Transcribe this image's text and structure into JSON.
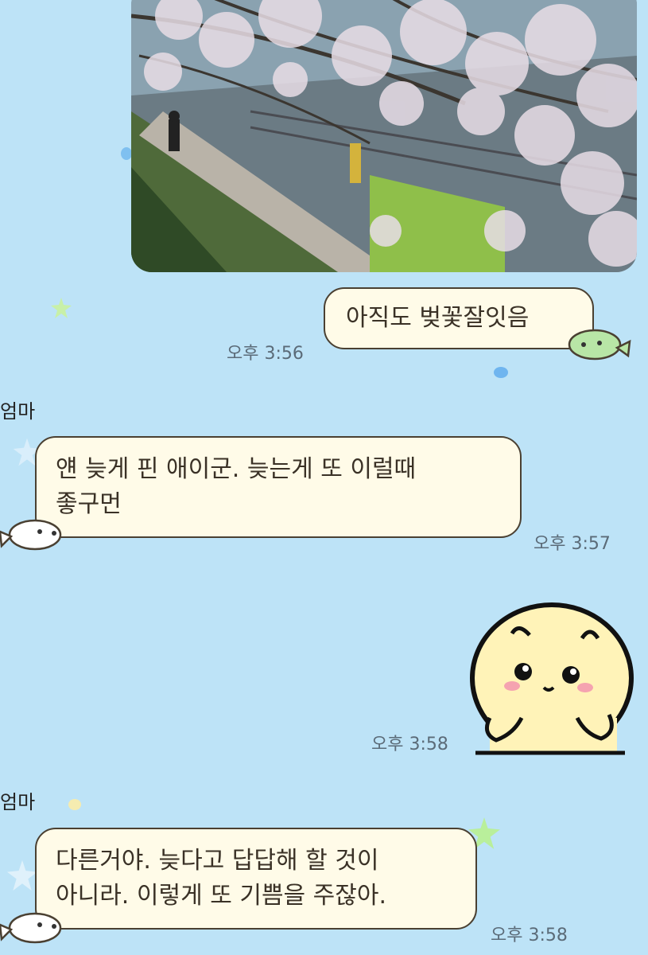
{
  "chat": {
    "messages": [
      {
        "side": "me",
        "type": "photo"
      },
      {
        "side": "me",
        "type": "text",
        "text": "아직도 벚꽃잘잇음",
        "time": "오후 3:56"
      },
      {
        "side": "other",
        "sender": "엄마",
        "type": "text",
        "lines": [
          "얜 늦게 핀 애이군. 늦는게 또 이럴때",
          "좋구먼"
        ],
        "time": "오후 3:57"
      },
      {
        "side": "me",
        "type": "sticker",
        "sticker": "blushing-yellow-character-sticker",
        "time": "오후 3:58"
      },
      {
        "side": "other",
        "sender": "엄마",
        "type": "text",
        "lines": [
          "다른거야. 늦다고 답답해 할 것이",
          "아니라. 이렇게 또 기쁨을 주잖아."
        ],
        "time": "오후 3:58"
      }
    ]
  },
  "colors": {
    "background": "#bde3f7",
    "bubble": "#fffbe8",
    "bubble_border": "#4a4032",
    "time_text": "#5b6b78"
  }
}
